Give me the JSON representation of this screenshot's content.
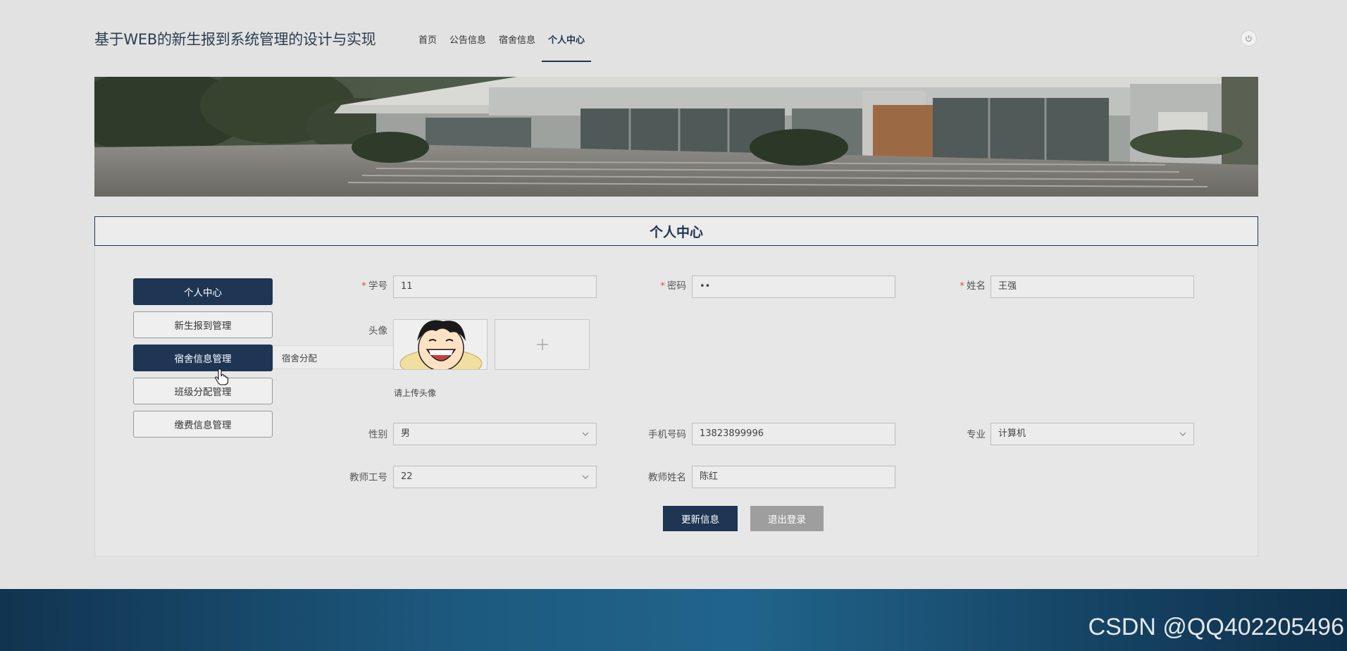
{
  "header": {
    "site_title": "基于WEB的新生报到系统管理的设计与实现",
    "nav": [
      "首页",
      "公告信息",
      "宿舍信息",
      "个人中心"
    ],
    "active_nav": "个人中心"
  },
  "section_title": "个人中心",
  "side_menu": {
    "items": [
      {
        "label": "个人中心",
        "active": true
      },
      {
        "label": "新生报到管理",
        "active": false
      },
      {
        "label": "宿舍信息管理",
        "active": true
      },
      {
        "label": "班级分配管理",
        "active": false
      },
      {
        "label": "缴费信息管理",
        "active": false
      }
    ],
    "submenu": {
      "label": "宿舍分配"
    }
  },
  "form": {
    "student_id": {
      "label": "学号",
      "value": "11",
      "required": true
    },
    "password": {
      "label": "密码",
      "value": "••",
      "required": true
    },
    "name": {
      "label": "姓名",
      "value": "王强",
      "required": true
    },
    "avatar": {
      "label": "头像",
      "hint": "请上传头像"
    },
    "gender": {
      "label": "性别",
      "value": "男"
    },
    "phone": {
      "label": "手机号码",
      "value": "13823899996"
    },
    "major": {
      "label": "专业",
      "value": "计算机"
    },
    "teacher_id": {
      "label": "教师工号",
      "value": "22"
    },
    "teacher_name": {
      "label": "教师姓名",
      "value": "陈红"
    },
    "update_button": "更新信息",
    "logout_button": "退出登录"
  },
  "footer": {
    "watermark": "CSDN @QQ402205496"
  },
  "colors": {
    "primary": "#1e3553",
    "required": "#e04b4b",
    "gray_button": "#9e9e9e"
  }
}
